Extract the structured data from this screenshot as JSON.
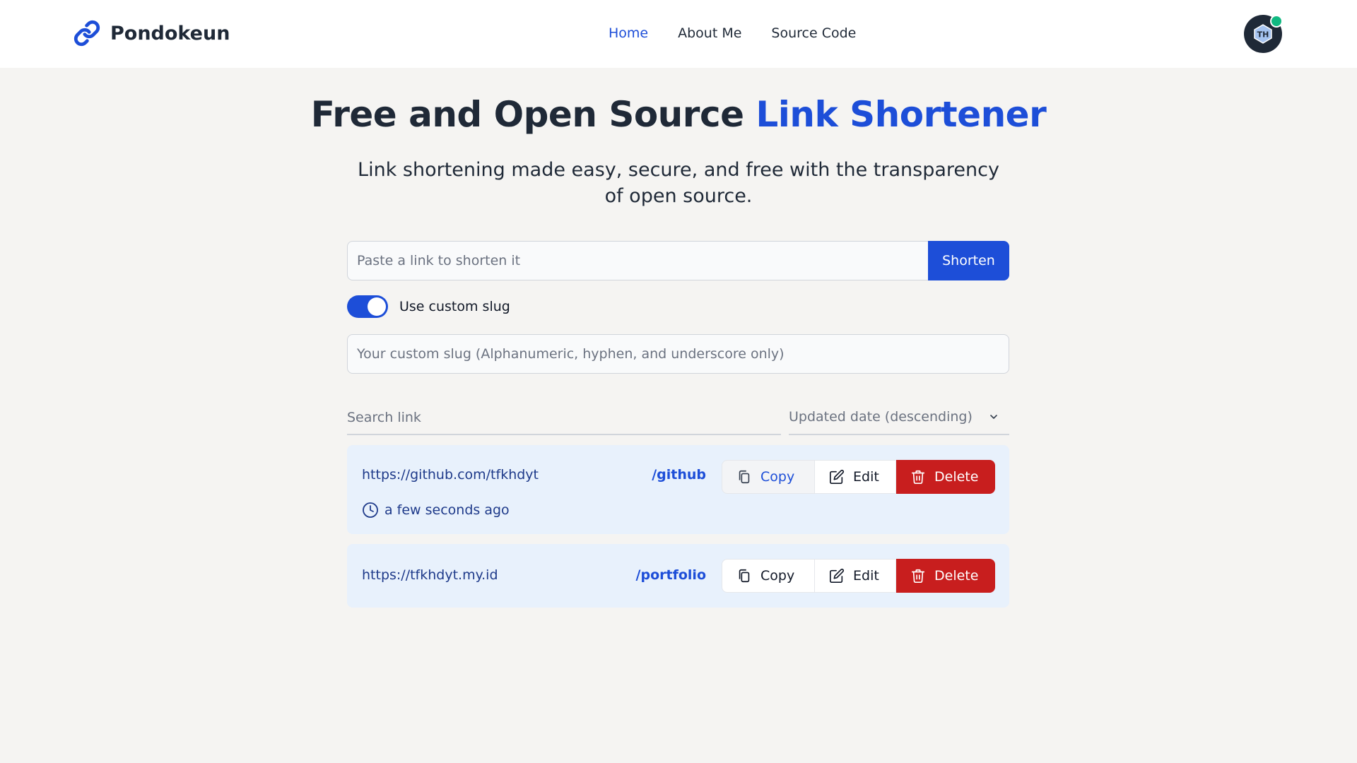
{
  "brand": {
    "name": "Pondokeun",
    "logo_icon": "link-icon",
    "accent_color": "#1d4ed8"
  },
  "nav": {
    "items": [
      {
        "label": "Home",
        "active": true
      },
      {
        "label": "About Me",
        "active": false
      },
      {
        "label": "Source Code",
        "active": false
      }
    ]
  },
  "user": {
    "avatar_initials": "TH",
    "status": "online",
    "status_color": "#10b981"
  },
  "hero": {
    "title_plain": "Free and Open Source ",
    "title_accent": "Link Shortener",
    "subtitle": "Link shortening made easy, secure, and free with the transparency of open source."
  },
  "form": {
    "url_placeholder": "Paste a link to shorten it",
    "url_value": "",
    "shorten_label": "Shorten",
    "custom_slug_toggle_label": "Use custom slug",
    "custom_slug_enabled": true,
    "slug_placeholder": "Your custom slug (Alphanumeric, hyphen, and underscore only)",
    "slug_value": ""
  },
  "list_controls": {
    "search_placeholder": "Search link",
    "sort_selected": "Updated date (descending)"
  },
  "links": [
    {
      "url": "https://github.com/tfkhdyt",
      "slug": "/github",
      "updated": "a few seconds ago",
      "copy_label": "Copy",
      "edit_label": "Edit",
      "delete_label": "Delete"
    },
    {
      "url": "https://tfkhdyt.my.id",
      "slug": "/portfolio",
      "copy_label": "Copy",
      "edit_label": "Edit",
      "delete_label": "Delete"
    }
  ],
  "colors": {
    "primary": "#1d4ed8",
    "danger": "#c81e1e",
    "card_background": "#e8f1fc",
    "page_background": "#f5f4f2"
  }
}
